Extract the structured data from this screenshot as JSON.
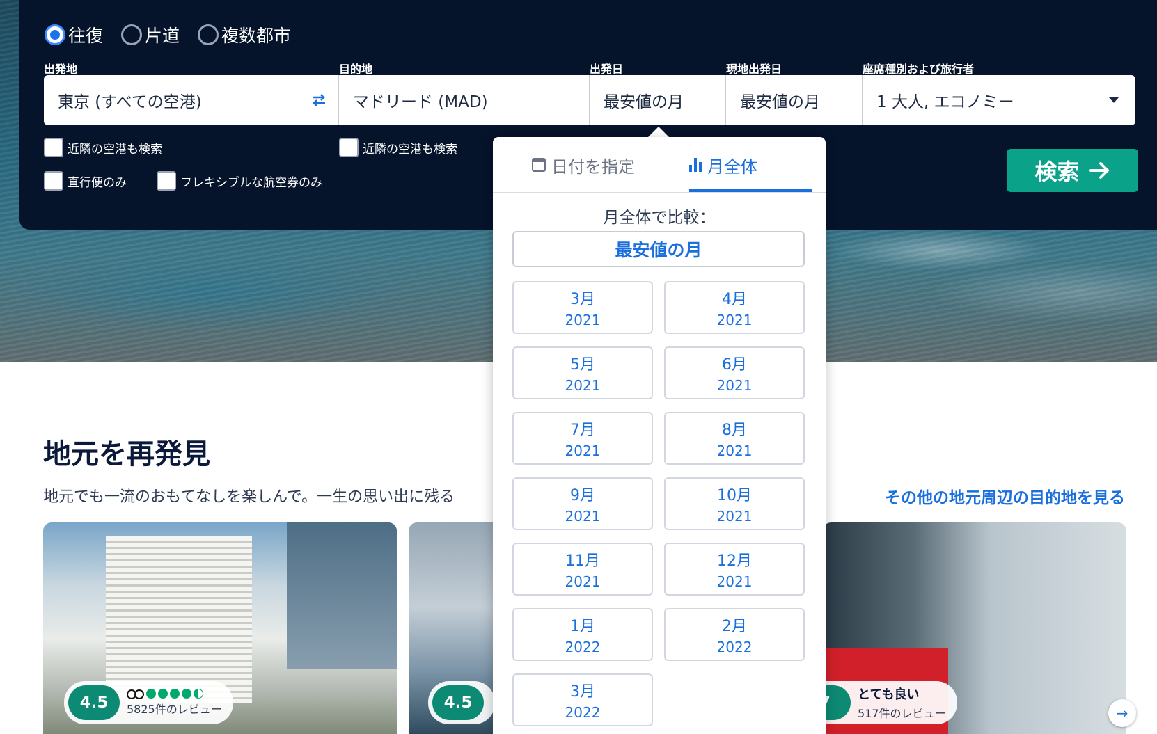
{
  "trip_types": [
    {
      "label": "往復",
      "selected": true
    },
    {
      "label": "片道",
      "selected": false
    },
    {
      "label": "複数都市",
      "selected": false
    }
  ],
  "fields": {
    "origin": {
      "label": "出発地",
      "value": "東京 (すべての空港)"
    },
    "destination": {
      "label": "目的地",
      "value": "マドリード (MAD)"
    },
    "depart": {
      "label": "出発日",
      "value": "最安値の月"
    },
    "return": {
      "label": "現地出発日",
      "value": "最安値の月"
    },
    "cabin": {
      "label": "座席種別および旅行者",
      "value": "1 大人, エコノミー"
    }
  },
  "checkboxes": {
    "nearby_origin": "近隣の空港も検索",
    "nearby_dest": "近隣の空港も検索",
    "direct_only": "直行便のみ",
    "flexible_only": "フレキシブルな航空券のみ"
  },
  "search_button": "検索",
  "popup": {
    "tab_date": "日付を指定",
    "tab_month": "月全体",
    "compare_label": "月全体で比較：",
    "cheapest_label": "最安値の月",
    "months": [
      {
        "month": "3月",
        "year": "2021"
      },
      {
        "month": "4月",
        "year": "2021"
      },
      {
        "month": "5月",
        "year": "2021"
      },
      {
        "month": "6月",
        "year": "2021"
      },
      {
        "month": "7月",
        "year": "2021"
      },
      {
        "month": "8月",
        "year": "2021"
      },
      {
        "month": "9月",
        "year": "2021"
      },
      {
        "month": "10月",
        "year": "2021"
      },
      {
        "month": "11月",
        "year": "2021"
      },
      {
        "month": "12月",
        "year": "2021"
      },
      {
        "month": "1月",
        "year": "2022"
      },
      {
        "month": "2月",
        "year": "2022"
      },
      {
        "month": "3月",
        "year": "2022"
      }
    ]
  },
  "section": {
    "title": "地元を再発見",
    "desc": "地元でも一流のおもてなしを楽しんで。一生の思い出に残る",
    "link": "その他の地元周辺の目的地を見る"
  },
  "cards": [
    {
      "score": "4.5",
      "reviews": "5825件のレビュー",
      "bubbles": 4.5
    },
    {
      "score": "4.5"
    },
    {
      "score": "7",
      "rating_label": "とても良い",
      "reviews": "517件のレビュー"
    }
  ],
  "colors": {
    "panel": "#05132b",
    "accent": "#1a6fde",
    "search_button": "#0aa38a",
    "score_badge": "#0c8a73"
  }
}
